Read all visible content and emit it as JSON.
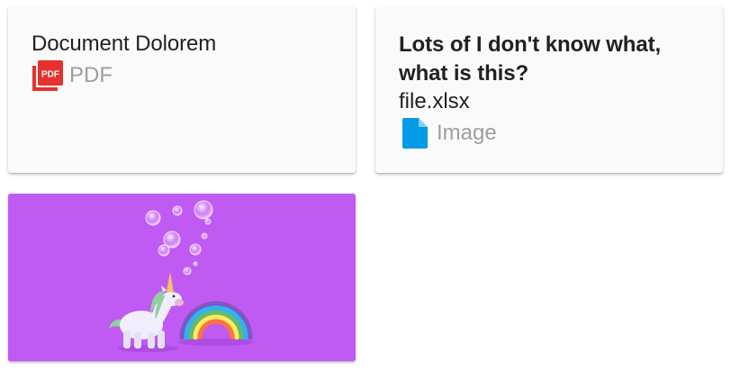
{
  "cards": [
    {
      "title": "Document Dolorem",
      "type_label": "PDF",
      "icon": "pdf-icon",
      "icon_text": "PDF",
      "icon_color": "#e5322d"
    },
    {
      "title": "Lots of I don't know what, what is this?",
      "file_name": "file.xlsx",
      "type_label": "Image",
      "icon": "file-icon",
      "icon_color": "#039be5"
    },
    {
      "image": "unicorn-rainbow-bubbles-illustration",
      "background": "#bf5af2"
    }
  ]
}
